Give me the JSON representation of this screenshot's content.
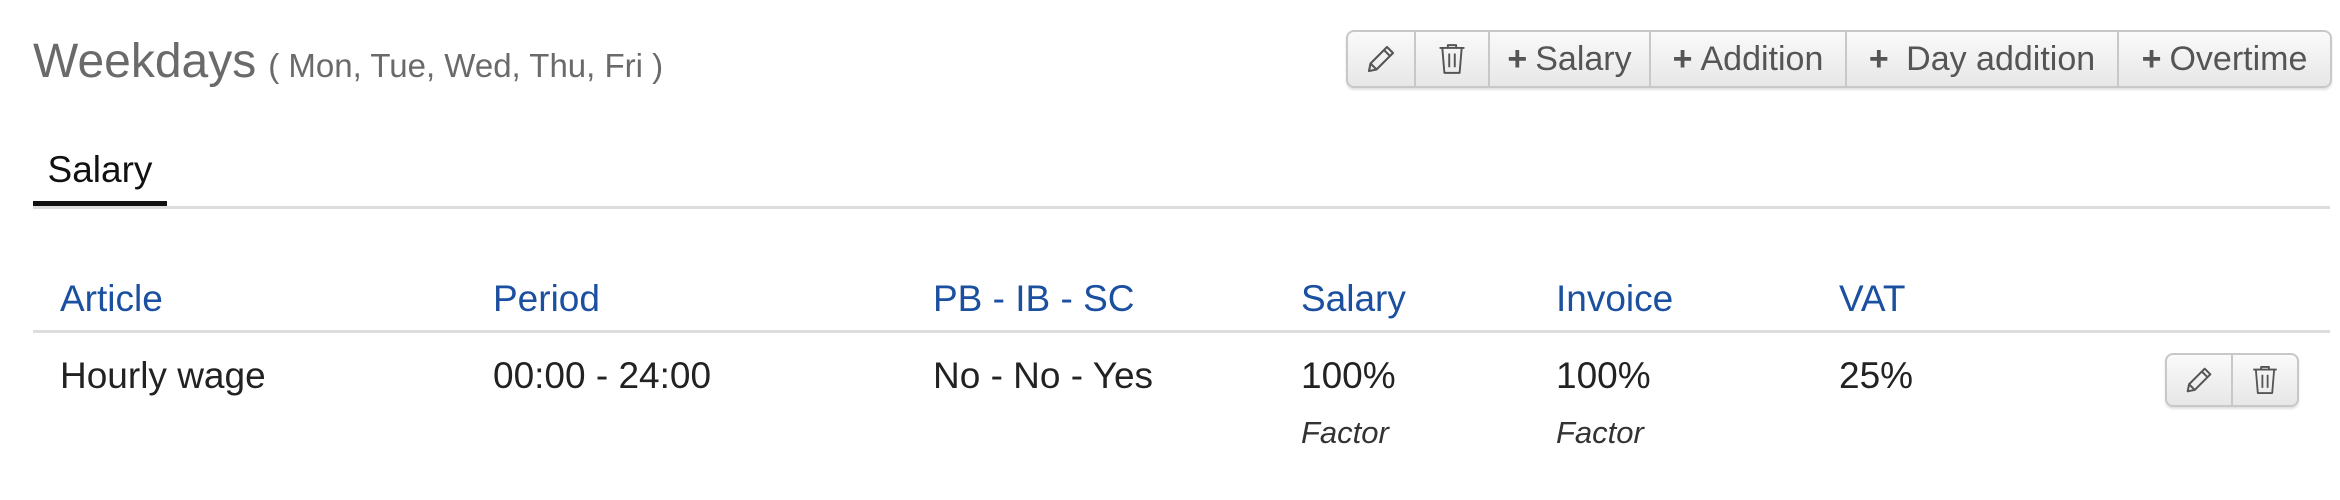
{
  "header": {
    "title": "Weekdays",
    "subtitle": "( Mon, Tue, Wed, Thu, Fri )"
  },
  "toolbar": {
    "edit_icon": "pencil-icon",
    "delete_icon": "trash-icon",
    "plus": "+",
    "salary_label": "Salary",
    "addition_label": "Addition",
    "day_addition_label": " Day addition",
    "overtime_label": "Overtime"
  },
  "tabs": [
    {
      "label": "Salary",
      "active": true
    }
  ],
  "table": {
    "columns": [
      "Article",
      "Period",
      "PB - IB - SC",
      "Salary",
      "Invoice",
      "VAT"
    ],
    "rows": [
      {
        "article": "Hourly wage",
        "period": "00:00 - 24:00",
        "pb_ib_sc": "No - No - Yes",
        "salary": "100%",
        "salary_sub": "Factor",
        "invoice": "100%",
        "invoice_sub": "Factor",
        "vat": "25%"
      }
    ]
  },
  "colors": {
    "header_link": "#1b4fa0",
    "title_gray": "#6a6a6a",
    "active_tab_underline": "#111111"
  }
}
